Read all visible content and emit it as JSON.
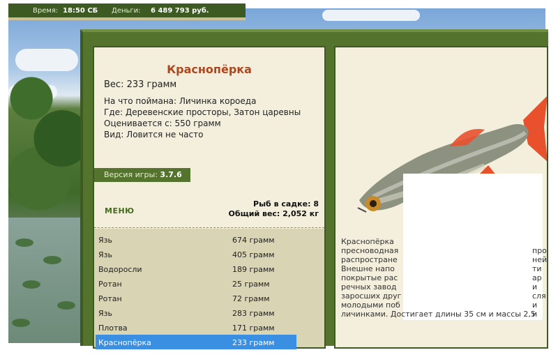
{
  "topbar": {
    "time_label": "Время:",
    "time_value": "18:50 СБ",
    "money_label": "Деньги:",
    "money_value": "6 489 793 руб."
  },
  "fish": {
    "name": "Краснопёрка",
    "weight": "Вес: 233 грамм",
    "caught_on": "На что поймана: Личинка короеда",
    "where": "Где: Деревенские просторы, Затон царевны",
    "value": "Оценивается с: 550 грамм",
    "type": "Вид: Ловится не часто"
  },
  "version": {
    "label": "Версия игры:",
    "value": "3.7.6"
  },
  "menu_label": "МЕНЮ",
  "stats": {
    "count": "Рыб в садке: 8",
    "total": "Общий вес: 2,052 кг"
  },
  "catch_list": [
    {
      "name": "Язь",
      "weight": "674 грамм"
    },
    {
      "name": "Язь",
      "weight": "405 грамм"
    },
    {
      "name": "Водоросли",
      "weight": "189 грамм"
    },
    {
      "name": "Ротан",
      "weight": "25 грамм"
    },
    {
      "name": "Ротан",
      "weight": "72 грамм"
    },
    {
      "name": "Язь",
      "weight": "283 грамм"
    },
    {
      "name": "Плотва",
      "weight": "171 грамм"
    },
    {
      "name": "Краснопёрка",
      "weight": "233 грамм"
    }
  ],
  "description": {
    "lines": [
      "Краснопёрка",
      "пресноводная",
      "распростране",
      "Внешне напо",
      "покрытые рас",
      "речных завод",
      "заросших друг",
      "молодыми поб",
      "личинками. Достигает длины 35 см и массы 2,5"
    ],
    "right_fragments": [
      "про",
      "ней",
      "ти",
      "ар",
      "и",
      "сля",
      "и",
      "и"
    ]
  },
  "colors": {
    "accent": "#b0461d",
    "panel": "#f3efdc",
    "frame": "#54742e",
    "selection": "#3a8fe2"
  },
  "icons": {
    "fish_image": "fish-illustration"
  }
}
